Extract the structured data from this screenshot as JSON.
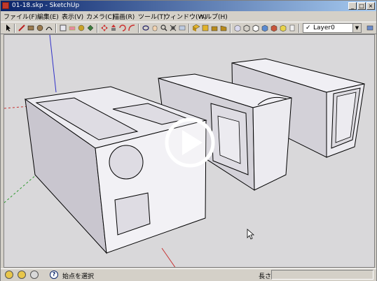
{
  "window": {
    "title": "01-18.skp - SketchUp"
  },
  "window_buttons": [
    "_",
    "□",
    "×"
  ],
  "menu": [
    {
      "label": "ファイル(F)"
    },
    {
      "label": "編集(E)"
    },
    {
      "label": "表示(V)"
    },
    {
      "label": "カメラ(C)"
    },
    {
      "label": "描画(R)"
    },
    {
      "label": "ツール(T)"
    },
    {
      "label": "ウィンドウ(W)"
    },
    {
      "label": "ヘルプ(H)"
    }
  ],
  "toolbar": {
    "layer_check": "✓",
    "layer_name": "Layer0",
    "dropdown_arrow": "▼"
  },
  "statusbar": {
    "hint": "始点を選択",
    "length_label": "長さ",
    "length_value": "",
    "help_icon": "?"
  },
  "colors": {
    "titlebar_start": "#0a246a",
    "titlebar_end": "#a6caf0",
    "viewport_bg": "#d9d8da",
    "face_light": "#ecebf0",
    "face_dark": "#c9c6cf",
    "edge": "#000000",
    "axis_red": "#c83232",
    "axis_green": "#2f9a2f",
    "axis_blue": "#3030c8"
  }
}
